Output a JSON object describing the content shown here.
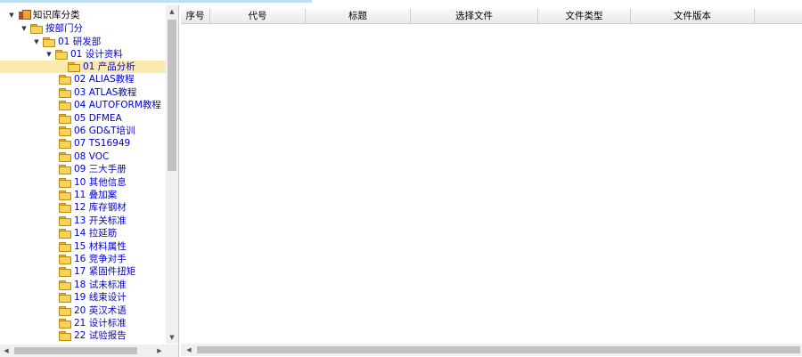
{
  "tree": {
    "root": {
      "label": "知识库分类",
      "toggle": "▼"
    },
    "level1": {
      "label": "按部门分",
      "toggle": "▼"
    },
    "level2": {
      "label": "01 研发部",
      "toggle": "▼"
    },
    "level3": {
      "label": "01 设计资料",
      "toggle": "▼"
    },
    "items": [
      {
        "label": "01 产品分析",
        "selected": true
      },
      {
        "label": "02 ALIAS教程"
      },
      {
        "label": "03 ATLAS教程"
      },
      {
        "label": "04 AUTOFORM教程"
      },
      {
        "label": "05 DFMEA"
      },
      {
        "label": "06 GD&T培训"
      },
      {
        "label": "07 TS16949"
      },
      {
        "label": "08 VOC"
      },
      {
        "label": "09 三大手册"
      },
      {
        "label": "10 其他信息"
      },
      {
        "label": "11 叠加案"
      },
      {
        "label": "12 库存钢材"
      },
      {
        "label": "13 开关标准"
      },
      {
        "label": "14 拉延筋"
      },
      {
        "label": "15 材料属性"
      },
      {
        "label": "16 竞争对手"
      },
      {
        "label": "17 紧固件扭矩"
      },
      {
        "label": "18 试未标准"
      },
      {
        "label": "19 线束设计"
      },
      {
        "label": "20 英汉术语"
      },
      {
        "label": "21 设计标准"
      },
      {
        "label": "22 试验报告"
      }
    ]
  },
  "scroll": {
    "up": "▲",
    "down": "▼",
    "left": "◀",
    "right": "▶"
  },
  "grid": {
    "columns": [
      "序号",
      "代号",
      "标题",
      "选择文件",
      "文件类型",
      "文件版本"
    ]
  }
}
